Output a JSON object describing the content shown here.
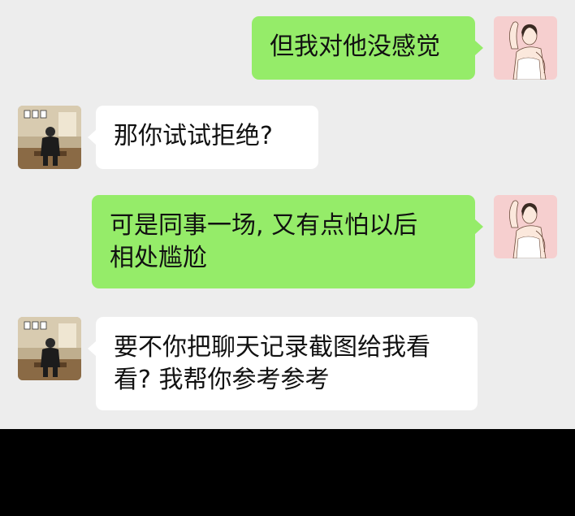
{
  "chat": {
    "messages": [
      {
        "sender": "me",
        "lines": [
          "但我对他没感觉"
        ]
      },
      {
        "sender": "friend",
        "lines": [
          "那你试试拒绝?"
        ]
      },
      {
        "sender": "me",
        "lines": [
          "可是同事一场, 又有点怕以后",
          "相处尴尬"
        ]
      },
      {
        "sender": "friend",
        "lines": [
          "要不你把聊天记录截图给我看",
          "看? 我帮你参考参考"
        ]
      }
    ]
  },
  "avatars": {
    "me": "woman-illustration-avatar",
    "friend": "man-photo-avatar"
  },
  "colors": {
    "chat_background": "#ededed",
    "outgoing_bubble": "#95ec69",
    "incoming_bubble": "#ffffff",
    "text": "#111111",
    "bottom_band": "#000000"
  }
}
